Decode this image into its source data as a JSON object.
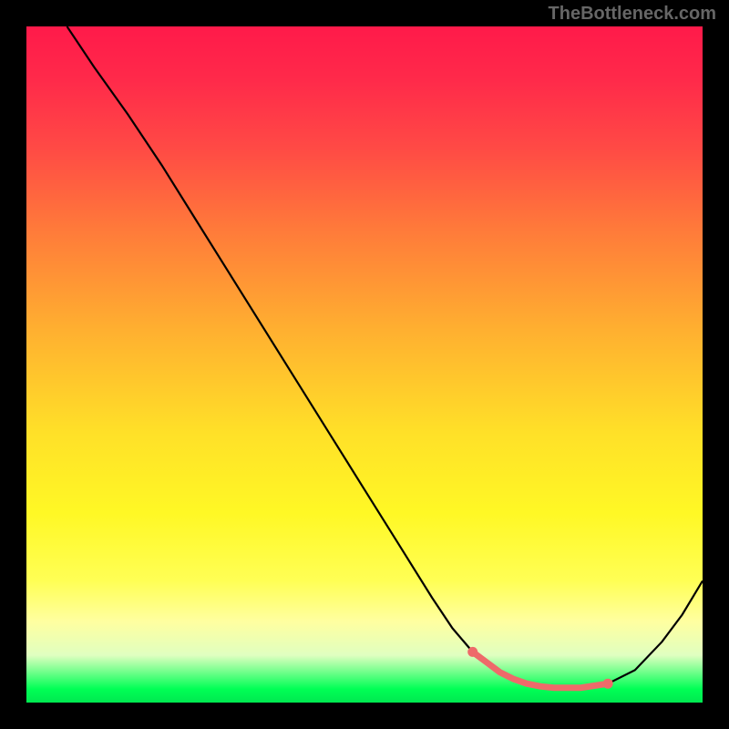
{
  "watermark": "TheBottleneck.com",
  "chart_data": {
    "type": "line",
    "title": "",
    "xlabel": "",
    "ylabel": "",
    "xlim": [
      0,
      100
    ],
    "ylim": [
      0,
      100
    ],
    "grid": false,
    "series": [
      {
        "name": "curve",
        "x": [
          6,
          10,
          15,
          20,
          25,
          30,
          35,
          40,
          45,
          50,
          55,
          60,
          63,
          66,
          70,
          74,
          78,
          82,
          86,
          90,
          94,
          97,
          100
        ],
        "y": [
          100,
          94,
          87,
          79.5,
          71.5,
          63.5,
          55.5,
          47.5,
          39.5,
          31.5,
          23.5,
          15.5,
          11,
          7.5,
          4.5,
          2.8,
          2.2,
          2.2,
          2.8,
          4.8,
          9,
          13,
          18
        ],
        "color": "#000000"
      },
      {
        "name": "highlight",
        "x": [
          66,
          68,
          70,
          72,
          74,
          76,
          78,
          80,
          82,
          84,
          86
        ],
        "y": [
          7.5,
          6,
          4.5,
          3.5,
          2.8,
          2.4,
          2.2,
          2.2,
          2.2,
          2.5,
          2.8
        ],
        "color": "#ee6a6a"
      }
    ]
  }
}
